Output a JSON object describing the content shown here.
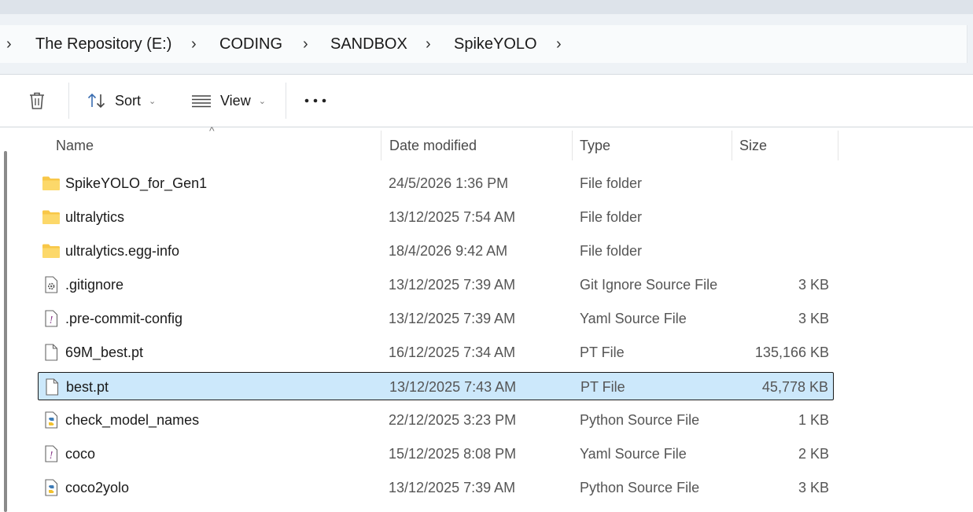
{
  "breadcrumb": {
    "items": [
      "The Repository (E:)",
      "CODING",
      "SANDBOX",
      "SpikeYOLO"
    ]
  },
  "toolbar": {
    "sort_label": "Sort",
    "view_label": "View"
  },
  "columns": {
    "name": "Name",
    "date": "Date modified",
    "type": "Type",
    "size": "Size"
  },
  "files": [
    {
      "name": "SpikeYOLO_for_Gen1",
      "date": "24/5/2026 1:36 PM",
      "type": "File folder",
      "size": "",
      "icon": "folder-icon"
    },
    {
      "name": "ultralytics",
      "date": "13/12/2025 7:54 AM",
      "type": "File folder",
      "size": "",
      "icon": "folder-icon"
    },
    {
      "name": "ultralytics.egg-info",
      "date": "18/4/2026 9:42 AM",
      "type": "File folder",
      "size": "",
      "icon": "folder-icon"
    },
    {
      "name": ".gitignore",
      "date": "13/12/2025 7:39 AM",
      "type": "Git Ignore Source File",
      "size": "3 KB",
      "icon": "config-file-icon"
    },
    {
      "name": ".pre-commit-config",
      "date": "13/12/2025 7:39 AM",
      "type": "Yaml Source File",
      "size": "3 KB",
      "icon": "yaml-file-icon"
    },
    {
      "name": "69M_best.pt",
      "date": "16/12/2025 7:34 AM",
      "type": "PT File",
      "size": "135,166 KB",
      "icon": "blank-file-icon"
    },
    {
      "name": "best.pt",
      "date": "13/12/2025 7:43 AM",
      "type": "PT File",
      "size": "45,778 KB",
      "icon": "blank-file-icon",
      "selected": true
    },
    {
      "name": "check_model_names",
      "date": "22/12/2025 3:23 PM",
      "type": "Python Source File",
      "size": "1 KB",
      "icon": "python-file-icon"
    },
    {
      "name": "coco",
      "date": "15/12/2025 8:08 PM",
      "type": "Yaml Source File",
      "size": "2 KB",
      "icon": "yaml-file-icon"
    },
    {
      "name": "coco2yolo",
      "date": "13/12/2025 7:39 AM",
      "type": "Python Source File",
      "size": "3 KB",
      "icon": "python-file-icon"
    }
  ],
  "colors": {
    "selection": "#cce8fb",
    "folder": "#f8c748",
    "python": "#3e7bb6"
  }
}
